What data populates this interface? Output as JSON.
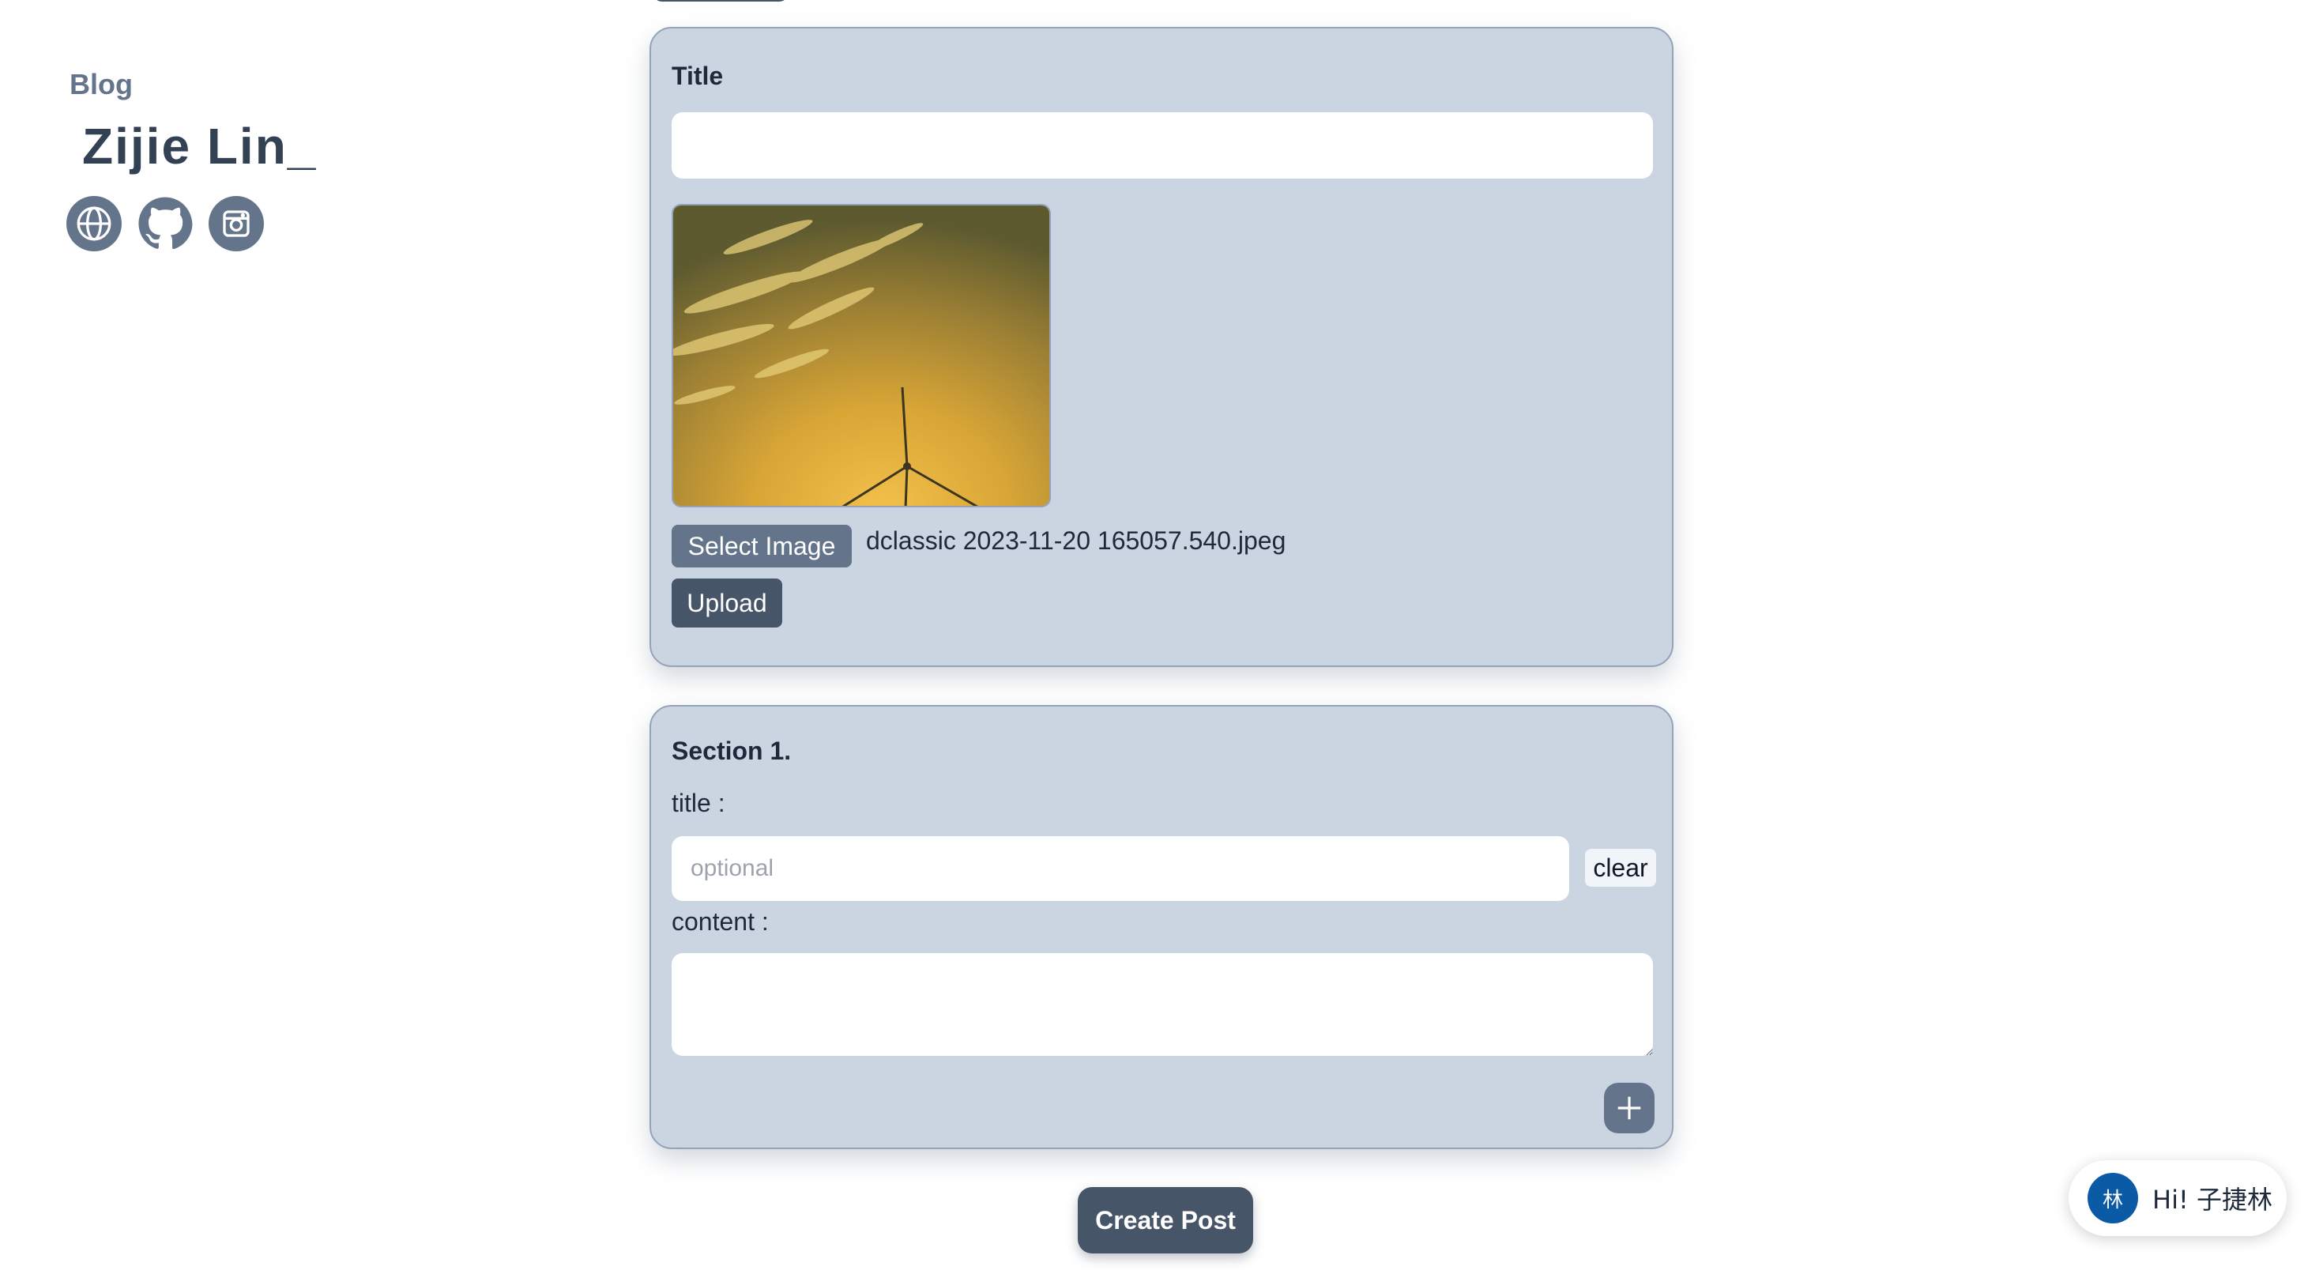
{
  "sidebar": {
    "label": "Blog",
    "name": "Zijie Lin_",
    "social_icons": [
      "globe-icon",
      "github-icon",
      "instagram-icon"
    ]
  },
  "cover_card": {
    "title_label": "Title",
    "title_value": "",
    "select_image_label": "Select Image",
    "file_name": "dclassic 2023-11-20 165057.540.jpeg",
    "upload_label": "Upload"
  },
  "section_card": {
    "heading": "Section 1.",
    "title_label": "title :",
    "title_placeholder": "optional",
    "clear_label": "clear",
    "content_label": "content :",
    "content_value": ""
  },
  "actions": {
    "create_post_label": "Create Post"
  },
  "chat_widget": {
    "avatar_text": "林",
    "greeting": "Hi! 子捷林"
  },
  "colors": {
    "card_bg": "#cbd5e1",
    "slate": "#64748b",
    "dark_slate": "#475569",
    "chat_avatar": "#0b5aa6"
  }
}
